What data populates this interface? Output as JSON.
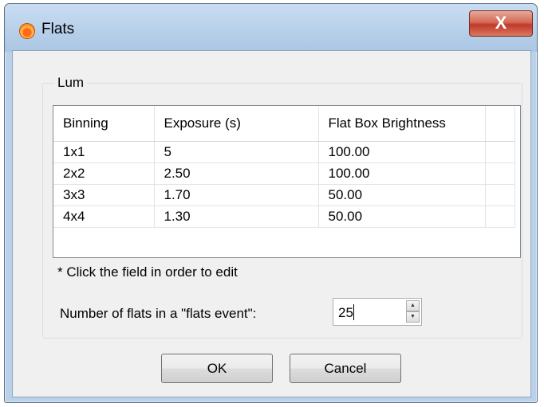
{
  "window": {
    "title": "Flats",
    "close_glyph": "X",
    "icon": "app-orange-icon"
  },
  "group": {
    "legend": "Lum"
  },
  "table": {
    "headers": [
      "Binning",
      "Exposure (s)",
      "Flat Box Brightness"
    ],
    "rows": [
      [
        "1x1",
        "5",
        "100.00"
      ],
      [
        "2x2",
        "2.50",
        "100.00"
      ],
      [
        "3x3",
        "1.70",
        "50.00"
      ],
      [
        "4x4",
        "1.30",
        "50.00"
      ]
    ]
  },
  "hint": "* Click the field in order to edit",
  "flats": {
    "label": "Number of flats in a \"flats event\":",
    "value": "25"
  },
  "buttons": {
    "ok": "OK",
    "cancel": "Cancel"
  }
}
